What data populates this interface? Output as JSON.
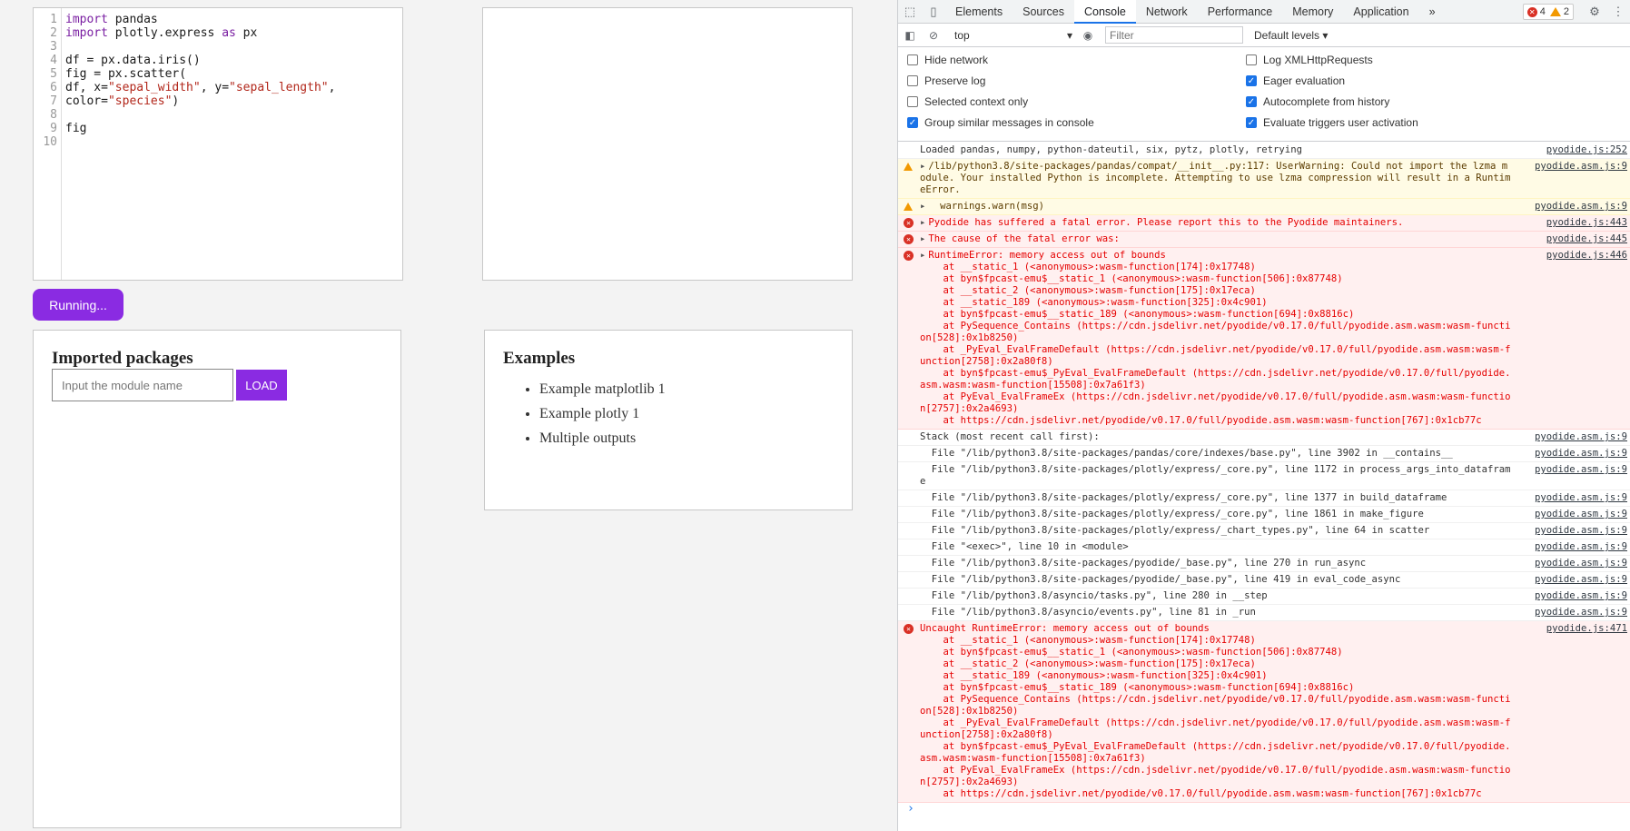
{
  "editor": {
    "line_numbers": [
      "1",
      "2",
      "3",
      "4",
      "5",
      "6",
      "7",
      "8",
      "9",
      "10"
    ],
    "lines": [
      [
        {
          "t": "import",
          "c": "kw"
        },
        {
          "t": " pandas",
          "c": ""
        }
      ],
      [
        {
          "t": "import",
          "c": "kw"
        },
        {
          "t": " plotly.express ",
          "c": ""
        },
        {
          "t": "as",
          "c": "kw"
        },
        {
          "t": " px",
          "c": ""
        }
      ],
      [
        {
          "t": "",
          "c": ""
        }
      ],
      [
        {
          "t": "df = px.data.iris()",
          "c": ""
        }
      ],
      [
        {
          "t": "fig = px.scatter(",
          "c": ""
        }
      ],
      [
        {
          "t": "df, x=",
          "c": ""
        },
        {
          "t": "\"sepal_width\"",
          "c": "str"
        },
        {
          "t": ", y=",
          "c": ""
        },
        {
          "t": "\"sepal_length\"",
          "c": "str"
        },
        {
          "t": ",",
          "c": ""
        }
      ],
      [
        {
          "t": "color=",
          "c": ""
        },
        {
          "t": "\"species\"",
          "c": "str"
        },
        {
          "t": ")",
          "c": ""
        }
      ],
      [
        {
          "t": "",
          "c": ""
        }
      ],
      [
        {
          "t": "fig",
          "c": ""
        }
      ],
      [
        {
          "t": "",
          "c": ""
        }
      ]
    ]
  },
  "run_button": {
    "label": "Running..."
  },
  "imports_panel": {
    "title": "Imported packages",
    "placeholder": "Input the module name",
    "load_label": "LOAD"
  },
  "examples_panel": {
    "title": "Examples",
    "items": [
      "Example matplotlib 1",
      "Example plotly 1",
      "Multiple outputs"
    ]
  },
  "devtools": {
    "tabs": [
      "Elements",
      "Sources",
      "Console",
      "Network",
      "Performance",
      "Memory",
      "Application"
    ],
    "active_tab": "Console",
    "more_tabs": "»",
    "error_count": "4",
    "warning_count": "2",
    "context": "top",
    "filter_placeholder": "Filter",
    "levels": "Default levels ▾",
    "settings": [
      {
        "label": "Hide network",
        "checked": false
      },
      {
        "label": "Log XMLHttpRequests",
        "checked": false
      },
      {
        "label": "Preserve log",
        "checked": false
      },
      {
        "label": "Eager evaluation",
        "checked": true
      },
      {
        "label": "Selected context only",
        "checked": false
      },
      {
        "label": "Autocomplete from history",
        "checked": true
      },
      {
        "label": "Group similar messages in console",
        "checked": true
      },
      {
        "label": "Evaluate triggers user activation",
        "checked": true
      }
    ],
    "messages": [
      {
        "type": "log",
        "text": "Loaded pandas, numpy, python-dateutil, six, pytz, plotly, retrying",
        "src": "pyodide.js:252"
      },
      {
        "type": "warn",
        "tri": true,
        "text": "/lib/python3.8/site-packages/pandas/compat/__init__.py:117: UserWarning: Could not import the lzma module. Your installed Python is incomplete. Attempting to use lzma compression will result in a RuntimeError.",
        "src": "pyodide.asm.js:9"
      },
      {
        "type": "warn",
        "tri": true,
        "text": "  warnings.warn(msg)",
        "src": "pyodide.asm.js:9"
      },
      {
        "type": "err",
        "tri": true,
        "text": "Pyodide has suffered a fatal error. Please report this to the Pyodide maintainers.",
        "src": "pyodide.js:443"
      },
      {
        "type": "err",
        "tri": true,
        "text": "The cause of the fatal error was:",
        "src": "pyodide.js:445"
      },
      {
        "type": "err",
        "tri": true,
        "text": "RuntimeError: memory access out of bounds\n    at __static_1 (<anonymous>:wasm-function[174]:0x17748)\n    at byn$fpcast-emu$__static_1 (<anonymous>:wasm-function[506]:0x87748)\n    at __static_2 (<anonymous>:wasm-function[175]:0x17eca)\n    at __static_189 (<anonymous>:wasm-function[325]:0x4c901)\n    at byn$fpcast-emu$__static_189 (<anonymous>:wasm-function[694]:0x8816c)\n    at PySequence_Contains (https://cdn.jsdelivr.net/pyodide/v0.17.0/full/pyodide.asm.wasm:wasm-function[528]:0x1b8250)\n    at _PyEval_EvalFrameDefault (https://cdn.jsdelivr.net/pyodide/v0.17.0/full/pyodide.asm.wasm:wasm-function[2758]:0x2a80f8)\n    at byn$fpcast-emu$_PyEval_EvalFrameDefault (https://cdn.jsdelivr.net/pyodide/v0.17.0/full/pyodide.asm.wasm:wasm-function[15508]:0x7a61f3)\n    at PyEval_EvalFrameEx (https://cdn.jsdelivr.net/pyodide/v0.17.0/full/pyodide.asm.wasm:wasm-function[2757]:0x2a4693)\n    at https://cdn.jsdelivr.net/pyodide/v0.17.0/full/pyodide.asm.wasm:wasm-function[767]:0x1cb77c",
        "src": "pyodide.js:446"
      },
      {
        "type": "log",
        "text": "Stack (most recent call first):",
        "src": "pyodide.asm.js:9"
      },
      {
        "type": "log",
        "text": "  File \"/lib/python3.8/site-packages/pandas/core/indexes/base.py\", line 3902 in __contains__",
        "src": "pyodide.asm.js:9"
      },
      {
        "type": "log",
        "text": "  File \"/lib/python3.8/site-packages/plotly/express/_core.py\", line 1172 in process_args_into_dataframe",
        "src": "pyodide.asm.js:9"
      },
      {
        "type": "log",
        "text": "  File \"/lib/python3.8/site-packages/plotly/express/_core.py\", line 1377 in build_dataframe",
        "src": "pyodide.asm.js:9"
      },
      {
        "type": "log",
        "text": "  File \"/lib/python3.8/site-packages/plotly/express/_core.py\", line 1861 in make_figure",
        "src": "pyodide.asm.js:9"
      },
      {
        "type": "log",
        "text": "  File \"/lib/python3.8/site-packages/plotly/express/_chart_types.py\", line 64 in scatter",
        "src": "pyodide.asm.js:9"
      },
      {
        "type": "log",
        "text": "  File \"<exec>\", line 10 in <module>",
        "src": "pyodide.asm.js:9"
      },
      {
        "type": "log",
        "text": "  File \"/lib/python3.8/site-packages/pyodide/_base.py\", line 270 in run_async",
        "src": "pyodide.asm.js:9"
      },
      {
        "type": "log",
        "text": "  File \"/lib/python3.8/site-packages/pyodide/_base.py\", line 419 in eval_code_async",
        "src": "pyodide.asm.js:9"
      },
      {
        "type": "log",
        "text": "  File \"/lib/python3.8/asyncio/tasks.py\", line 280 in __step",
        "src": "pyodide.asm.js:9"
      },
      {
        "type": "log",
        "text": "  File \"/lib/python3.8/asyncio/events.py\", line 81 in _run",
        "src": "pyodide.asm.js:9"
      },
      {
        "type": "err",
        "tri": false,
        "text": "Uncaught RuntimeError: memory access out of bounds\n    at __static_1 (<anonymous>:wasm-function[174]:0x17748)\n    at byn$fpcast-emu$__static_1 (<anonymous>:wasm-function[506]:0x87748)\n    at __static_2 (<anonymous>:wasm-function[175]:0x17eca)\n    at __static_189 (<anonymous>:wasm-function[325]:0x4c901)\n    at byn$fpcast-emu$__static_189 (<anonymous>:wasm-function[694]:0x8816c)\n    at PySequence_Contains (https://cdn.jsdelivr.net/pyodide/v0.17.0/full/pyodide.asm.wasm:wasm-function[528]:0x1b8250)\n    at _PyEval_EvalFrameDefault (https://cdn.jsdelivr.net/pyodide/v0.17.0/full/pyodide.asm.wasm:wasm-function[2758]:0x2a80f8)\n    at byn$fpcast-emu$_PyEval_EvalFrameDefault (https://cdn.jsdelivr.net/pyodide/v0.17.0/full/pyodide.asm.wasm:wasm-function[15508]:0x7a61f3)\n    at PyEval_EvalFrameEx (https://cdn.jsdelivr.net/pyodide/v0.17.0/full/pyodide.asm.wasm:wasm-function[2757]:0x2a4693)\n    at https://cdn.jsdelivr.net/pyodide/v0.17.0/full/pyodide.asm.wasm:wasm-function[767]:0x1cb77c",
        "src": "pyodide.js:471"
      }
    ],
    "prompt": "›"
  }
}
